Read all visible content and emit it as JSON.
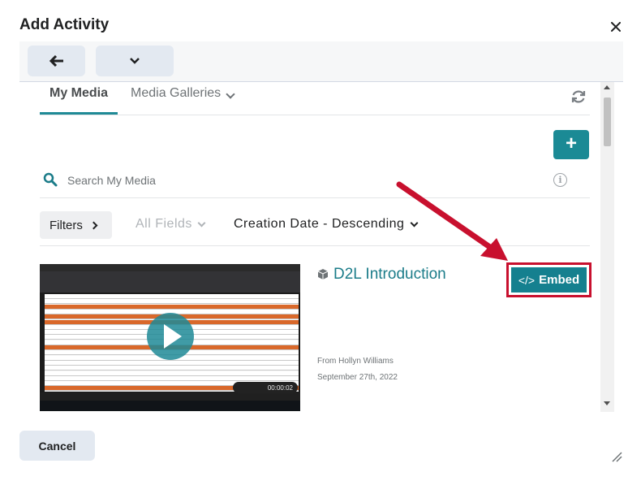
{
  "dialog": {
    "title": "Add Activity"
  },
  "toolbar": {
    "back_icon": "arrow-left-icon",
    "more_icon": "chevron-down-icon"
  },
  "tabs": [
    {
      "label": "My Media",
      "active": true
    },
    {
      "label": "Media Galleries",
      "active": false
    }
  ],
  "search": {
    "placeholder": "Search My Media",
    "value": ""
  },
  "filters": {
    "filters_label": "Filters",
    "field_select": "All Fields",
    "sort_select": "Creation Date - Descending"
  },
  "media_items": [
    {
      "title": "D2L Introduction",
      "owner": "From Hollyn Williams September 27th, 2022",
      "embed_label": "Embed",
      "embed_glyph": "</>",
      "thumbnail_timer": "00:00:02"
    }
  ],
  "footer": {
    "cancel_label": "Cancel"
  },
  "colors": {
    "accent": "#1b8a95",
    "highlight": "#c8102e",
    "link": "#1b7c89"
  }
}
